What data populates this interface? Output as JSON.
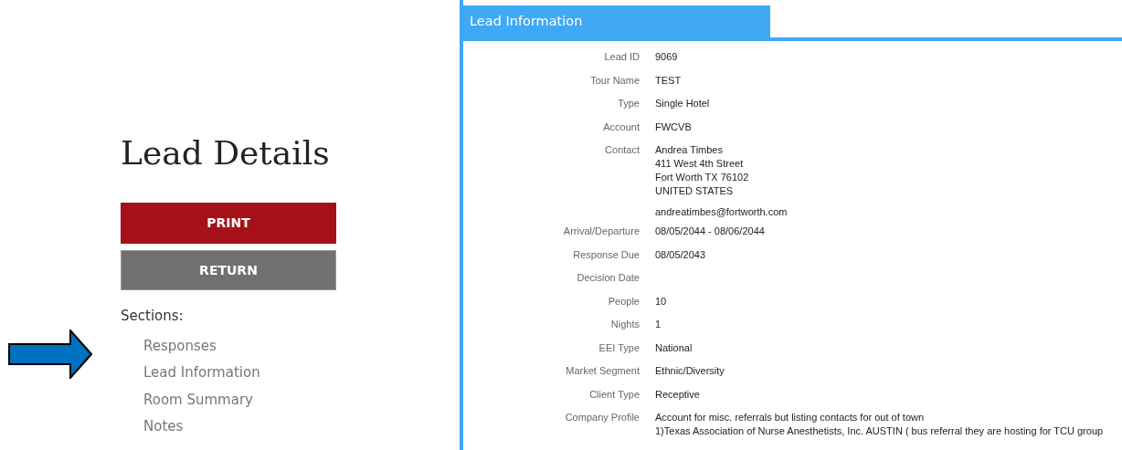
{
  "page": {
    "title": "Lead Details"
  },
  "buttons": [
    {
      "label": "PRINT",
      "kind": "primary"
    },
    {
      "label": "RETURN",
      "kind": "secondary"
    }
  ],
  "sections": {
    "heading": "Sections:",
    "items": [
      "Responses",
      "Lead Information",
      "Room Summary",
      "Notes"
    ]
  },
  "panel": {
    "title": "Lead Information",
    "fields": [
      {
        "label": "Lead ID",
        "lines": [
          "9069"
        ]
      },
      {
        "label": "Tour Name",
        "lines": [
          "TEST"
        ]
      },
      {
        "label": "Type",
        "lines": [
          "Single Hotel"
        ]
      },
      {
        "label": "Account",
        "lines": [
          "FWCVB"
        ]
      },
      {
        "label": "Contact",
        "lines": [
          "Andrea Timbes",
          "411 West 4th Street",
          "Fort Worth TX 76102",
          "UNITED STATES"
        ],
        "email": "andreatimbes@fortworth.com"
      },
      {
        "label": "Arrival/Departure",
        "lines": [
          "08/05/2044 - 08/06/2044"
        ]
      },
      {
        "label": "Response Due",
        "lines": [
          "08/05/2043"
        ]
      },
      {
        "label": "Decision Date"
      },
      {
        "label": "People",
        "lines": [
          "10"
        ]
      },
      {
        "label": "Nights",
        "lines": [
          "1"
        ]
      },
      {
        "label": "EEI Type",
        "lines": [
          "National"
        ]
      },
      {
        "label": "Market Segment",
        "lines": [
          "Ethnic/Diversity"
        ]
      },
      {
        "label": "Client Type",
        "lines": [
          "Receptive"
        ]
      },
      {
        "label": "Company Profile",
        "lines": [
          "Account for misc. referrals but listing contacts for out of town",
          "1)Texas Association of Nurse Anesthetists, Inc. AUSTIN ( bus referral they are hosting for TCU group"
        ]
      }
    ]
  }
}
